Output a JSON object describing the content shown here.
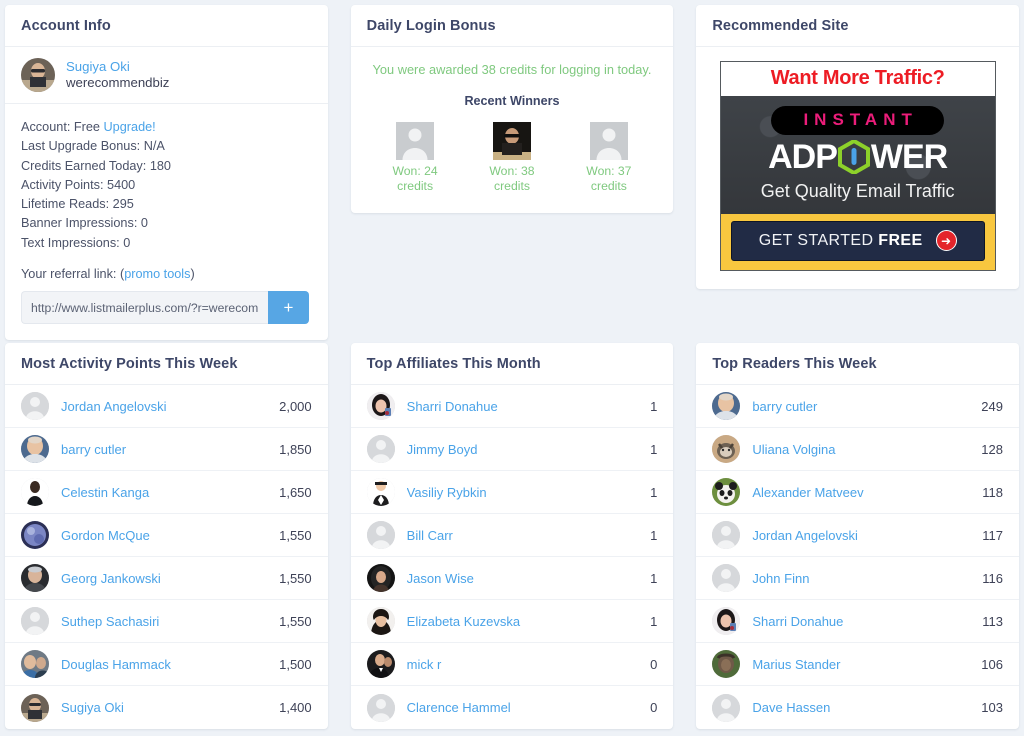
{
  "account": {
    "title": "Account Info",
    "display_name": "Sugiya Oki",
    "username": "werecommendbiz",
    "avatar": "photo-avatar",
    "lines": [
      {
        "label": "Account:",
        "value": "Free",
        "link": "Upgrade!"
      },
      {
        "label": "Last Upgrade Bonus:",
        "value": "N/A"
      },
      {
        "label": "Credits Earned Today:",
        "value": "180"
      },
      {
        "label": "Activity Points:",
        "value": "5400"
      },
      {
        "label": "Lifetime Reads:",
        "value": "295"
      },
      {
        "label": "Banner Impressions:",
        "value": "0"
      },
      {
        "label": "Text Impressions:",
        "value": "0"
      }
    ],
    "line_1": "Account: Free",
    "upgrade_link": "Upgrade!",
    "line_2": "Last Upgrade Bonus: N/A",
    "line_3": "Credits Earned Today: 180",
    "line_4": "Activity Points: 5400",
    "line_5": "Lifetime Reads: 295",
    "line_6": "Banner Impressions: 0",
    "line_7": "Text Impressions: 0",
    "referral_label_before": "Your referral link: (",
    "referral_link_text": "promo tools",
    "referral_label_after": ")",
    "referral_url": "http://www.listmailerplus.com/?r=werecommendbiz",
    "referral_placeholder": "http://www.listmailerplus.com/?r=werecommendbiz",
    "add_button_label": "+"
  },
  "bonus": {
    "title": "Daily Login Bonus",
    "message": "You were awarded 38 credits for logging in today.",
    "credits_awarded": 38,
    "winners_title": "Recent Winners",
    "winners": [
      {
        "avatar": "placeholder-avatar",
        "line1": "Won: 24",
        "line2": "credits",
        "amount": 24
      },
      {
        "avatar": "photo-avatar",
        "line1": "Won: 38",
        "line2": "credits",
        "amount": 38
      },
      {
        "avatar": "placeholder-avatar",
        "line1": "Won: 37",
        "line2": "credits",
        "amount": 37
      }
    ]
  },
  "recommended": {
    "title": "Recommended Site",
    "ad": {
      "headline": "Want More Traffic?",
      "brand_badge": "INSTANT",
      "brand_left": "ADP",
      "brand_right": "WER",
      "tagline": "Get Quality Email Traffic",
      "cta_text": "GET STARTED ",
      "cta_emphasis": "FREE",
      "cta_arrow": "➜",
      "colors": {
        "headline": "#ed1c24",
        "badge_text": "#ec1d7a",
        "cta_band": "#f8c73f",
        "cta_button": "#212b45",
        "arrow": "#e4252b",
        "hex": "#8dd12a"
      }
    }
  },
  "activity": {
    "title": "Most Activity Points This Week",
    "rows": [
      {
        "avatar": "placeholder-avatar",
        "name": "Jordan Angelovski",
        "value": "2,000"
      },
      {
        "avatar": "photo-avatar",
        "name": "barry cutler",
        "value": "1,850"
      },
      {
        "avatar": "photo-avatar",
        "name": "Celestin Kanga",
        "value": "1,650"
      },
      {
        "avatar": "photo-avatar",
        "name": "Gordon McQue",
        "value": "1,550"
      },
      {
        "avatar": "photo-avatar",
        "name": "Georg Jankowski",
        "value": "1,550"
      },
      {
        "avatar": "placeholder-avatar",
        "name": "Suthep Sachasiri",
        "value": "1,550"
      },
      {
        "avatar": "photo-avatar",
        "name": "Douglas Hammack",
        "value": "1,500"
      },
      {
        "avatar": "photo-avatar",
        "name": "Sugiya Oki",
        "value": "1,400"
      }
    ]
  },
  "affiliates": {
    "title": "Top Affiliates This Month",
    "rows": [
      {
        "avatar": "photo-avatar",
        "name": "Sharri Donahue",
        "value": "1"
      },
      {
        "avatar": "placeholder-avatar",
        "name": "Jimmy Boyd",
        "value": "1"
      },
      {
        "avatar": "photo-avatar",
        "name": "Vasiliy Rybkin",
        "value": "1"
      },
      {
        "avatar": "placeholder-avatar",
        "name": "Bill Carr",
        "value": "1"
      },
      {
        "avatar": "photo-avatar",
        "name": "Jason Wise",
        "value": "1"
      },
      {
        "avatar": "photo-avatar",
        "name": "Elizabeta Kuzevska",
        "value": "1"
      },
      {
        "avatar": "photo-avatar",
        "name": "mick r",
        "value": "0"
      },
      {
        "avatar": "placeholder-avatar",
        "name": "Clarence Hammel",
        "value": "0"
      }
    ]
  },
  "readers": {
    "title": "Top Readers This Week",
    "rows": [
      {
        "avatar": "photo-avatar",
        "name": "barry cutler",
        "value": "249"
      },
      {
        "avatar": "photo-avatar",
        "name": "Uliana Volgina",
        "value": "128"
      },
      {
        "avatar": "photo-avatar",
        "name": "Alexander Matveev",
        "value": "118"
      },
      {
        "avatar": "placeholder-avatar",
        "name": "Jordan Angelovski",
        "value": "117"
      },
      {
        "avatar": "placeholder-avatar",
        "name": "John Finn",
        "value": "116"
      },
      {
        "avatar": "photo-avatar",
        "name": "Sharri Donahue",
        "value": "113"
      },
      {
        "avatar": "photo-avatar",
        "name": "Marius Stander",
        "value": "106"
      },
      {
        "avatar": "placeholder-avatar",
        "name": "Dave Hassen",
        "value": "103"
      }
    ]
  },
  "theme": {
    "page_background": "#eef2f7",
    "card_background": "#ffffff",
    "link_color": "#4aa3e8",
    "heading_color": "#3e4768",
    "success_color": "#7fc97f",
    "accent_button": "#57a6e4"
  }
}
